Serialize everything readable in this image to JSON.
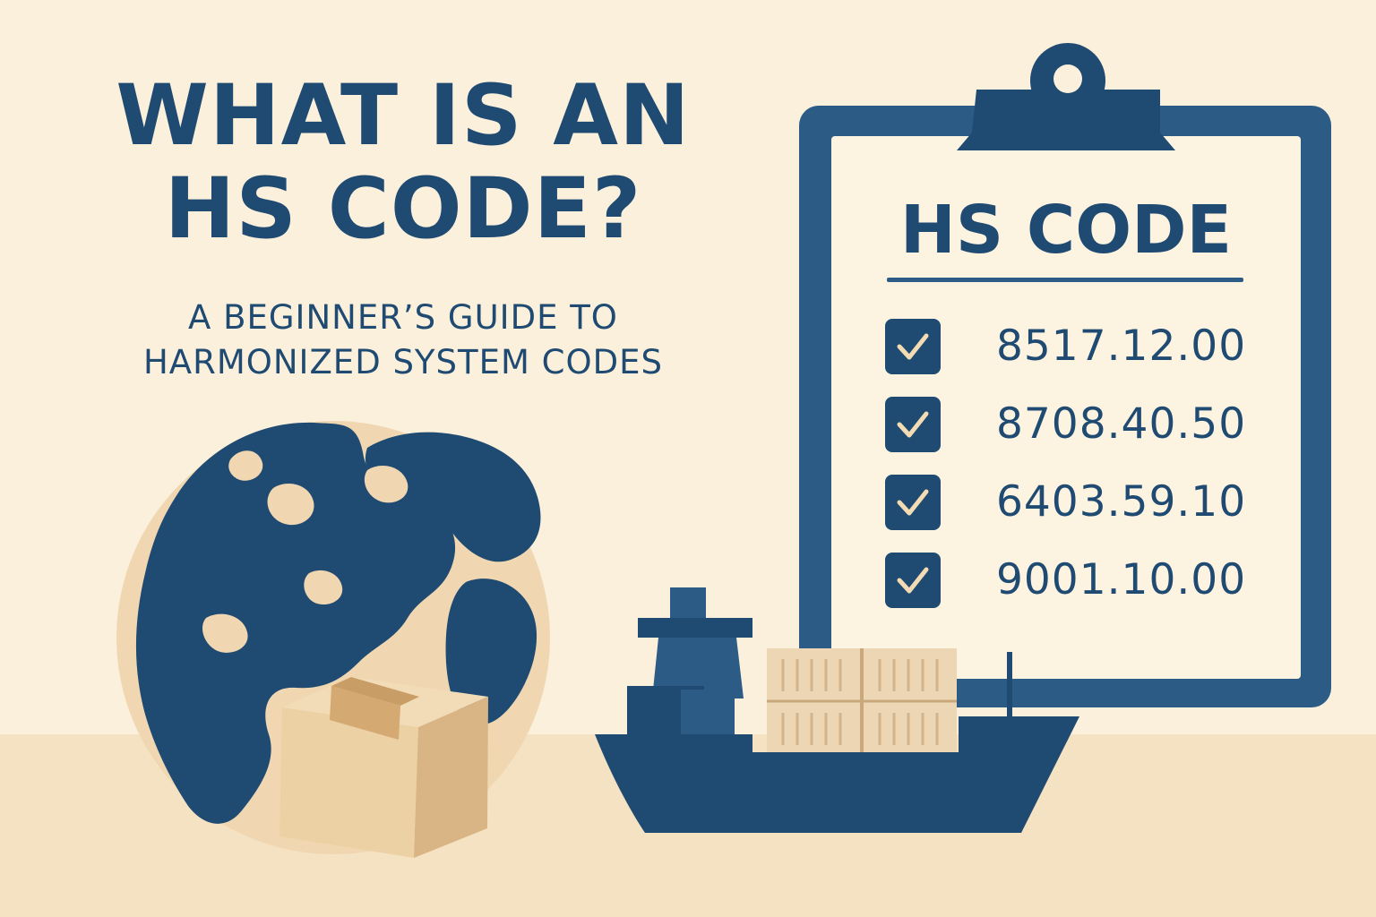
{
  "hero": {
    "title_line1": "WHAT IS AN",
    "title_line2": "HS CODE?",
    "subtitle_line1": "A BEGINNER’S GUIDE TO",
    "subtitle_line2": "HARMONIZED SYSTEM CODES"
  },
  "clipboard": {
    "heading": "HS CODE",
    "codes": [
      {
        "code": "8517.12.00",
        "checked": true
      },
      {
        "code": "8708.40.50",
        "checked": true
      },
      {
        "code": "6403.59.10",
        "checked": true
      },
      {
        "code": "9001.10.00",
        "checked": true
      }
    ]
  },
  "illustrations": {
    "globe": "globe-icon",
    "box": "cardboard-box-icon",
    "ship": "cargo-ship-icon",
    "clipboard": "clipboard-icon",
    "check": "checkmark-icon"
  },
  "colors": {
    "background": "#fbf0dc",
    "floor": "#f4e2c2",
    "navy": "#1f4a72",
    "clipboard_blue": "#2c5b86",
    "paper": "#fdf3e1",
    "tan": "#f0d7b1",
    "check_mark": "#f3dcb3"
  }
}
